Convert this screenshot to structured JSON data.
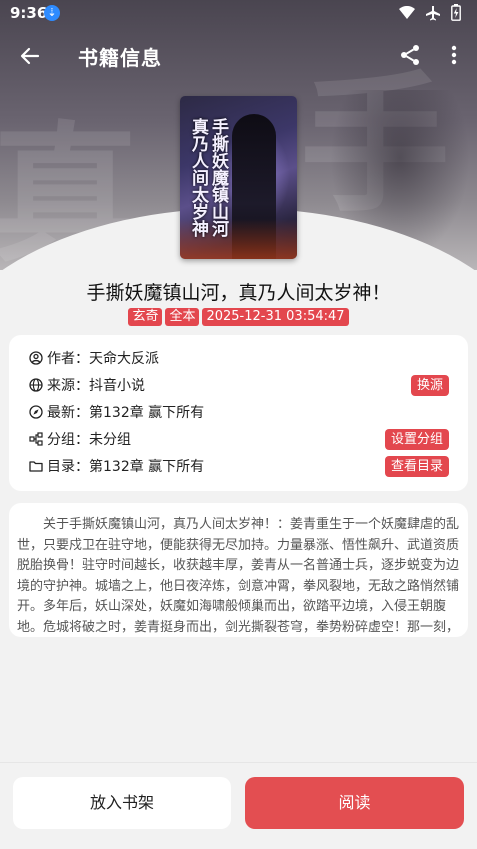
{
  "status_bar": {
    "time": "9:36",
    "icons": [
      "download-badge-icon",
      "wifi-icon",
      "airplane-icon",
      "battery-icon"
    ]
  },
  "app_bar": {
    "title": "书籍信息",
    "icons": [
      "back-arrow-icon",
      "share-icon",
      "more-vert-icon"
    ]
  },
  "cover": {
    "title_line1": "手撕妖魔镇山河",
    "title_line2": "真乃人间太岁神"
  },
  "book": {
    "name": "手撕妖魔镇山河，真乃人间太岁神！",
    "tags": [
      "玄奇",
      "全本",
      "2025-12-31 03:54:47"
    ]
  },
  "info": {
    "author": "作者：天命大反派",
    "source": "来源：抖音小说",
    "latest": "最新：第132章 赢下所有",
    "group": "分组：未分组",
    "toc": "目录：第132章 赢下所有",
    "change_source_button": "换源",
    "set_group_button": "设置分组",
    "view_toc_button": "查看目录"
  },
  "intro": {
    "text": "关于手撕妖魔镇山河，真乃人间太岁神！：姜青重生于一个妖魔肆虐的乱世，只要戍卫在驻守地，便能获得无尽加持。力量暴涨、悟性飙升、武道资质脱胎换骨！驻守时间越长，收获越丰厚，姜青从一名普通士兵，逐步蜕变为边境的守护神。城墙之上，他日夜淬炼，剑意冲霄，拳风裂地，无敌之路悄然铺开。多年后，妖山深处，妖魔如海啸般倾巢而出，欲踏平边境，入侵王朝腹地。危城将破之时，姜青挺身而出，剑光撕裂苍穹，拳势粉碎虚空！那一刻，天下皆知，人族屹立不倒，只因边境出了"
  },
  "bottom": {
    "add_shelf_button": "放入书架",
    "read_button": "阅读"
  },
  "colors": {
    "accent": "#e3474e",
    "read_button": "#e34e51",
    "background": "#f2f2f2"
  }
}
